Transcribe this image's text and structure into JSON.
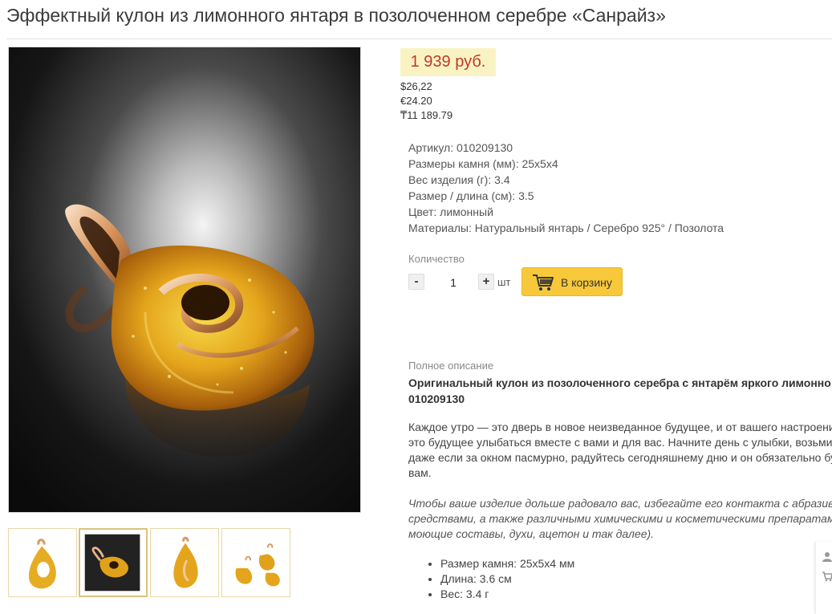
{
  "page": {
    "title": "Эффектный кулон из лимонного янтаря в позолоченном серебре «Санрайз»"
  },
  "price": {
    "main": "1 939 руб.",
    "usd": "$26,22",
    "eur": "€24.20",
    "kzt": "₸11 189.79"
  },
  "specs": [
    {
      "label": "Артикул:",
      "value": "010209130"
    },
    {
      "label": "Размеры камня (мм):",
      "value": "25х5х4"
    },
    {
      "label": "Вес изделия (г):",
      "value": "3.4"
    },
    {
      "label": "Размер / длина (см):",
      "value": "3.5"
    },
    {
      "label": "Цвет:",
      "value": "лимонный"
    },
    {
      "label": "Материалы:",
      "value": "Натуральный янтарь / Серебро 925° / Позолота"
    }
  ],
  "quantity": {
    "label": "Количество",
    "minus": "-",
    "value": "1",
    "plus": "+",
    "unit": "шт"
  },
  "cart": {
    "label": "В корзину",
    "icon": "cart-icon"
  },
  "description": {
    "label": "Полное описание",
    "title_line1": "Оригинальный кулон из позолоченного серебра с янтарём яркого лимонно",
    "title_line2": "010209130",
    "para1": [
      "Каждое утро — это дверь в новое неизведанное будущее, и от вашего настроени",
      "это будущее улыбаться вместе с вами и для вас. Начните день с улыбки, возьми",
      "даже если за окном пасмурно, радуйтесь сегодняшнему дню и он обязательно бу",
      "вам."
    ],
    "para2": [
      "Чтобы ваше изделие дольше радовало вас, избегайте его контакта с абразив",
      "средствами, а также различными химическими и косметическими препаратам",
      "моющие составы, духи, ацетон и так далее)."
    ],
    "bullets": [
      "Размер камня: 25х5х4 мм",
      "Длина: 3.6 см",
      "Вес: 3.4 г"
    ]
  },
  "gallery": {
    "active_index": 1,
    "thumbs": [
      "thumb-front",
      "thumb-dark",
      "thumb-side",
      "thumb-set"
    ]
  },
  "colors": {
    "price_bg": "#f9f3c3",
    "price_text": "#c0392b",
    "cart_button": "#f7c93a",
    "amber": "#e0a21a"
  }
}
